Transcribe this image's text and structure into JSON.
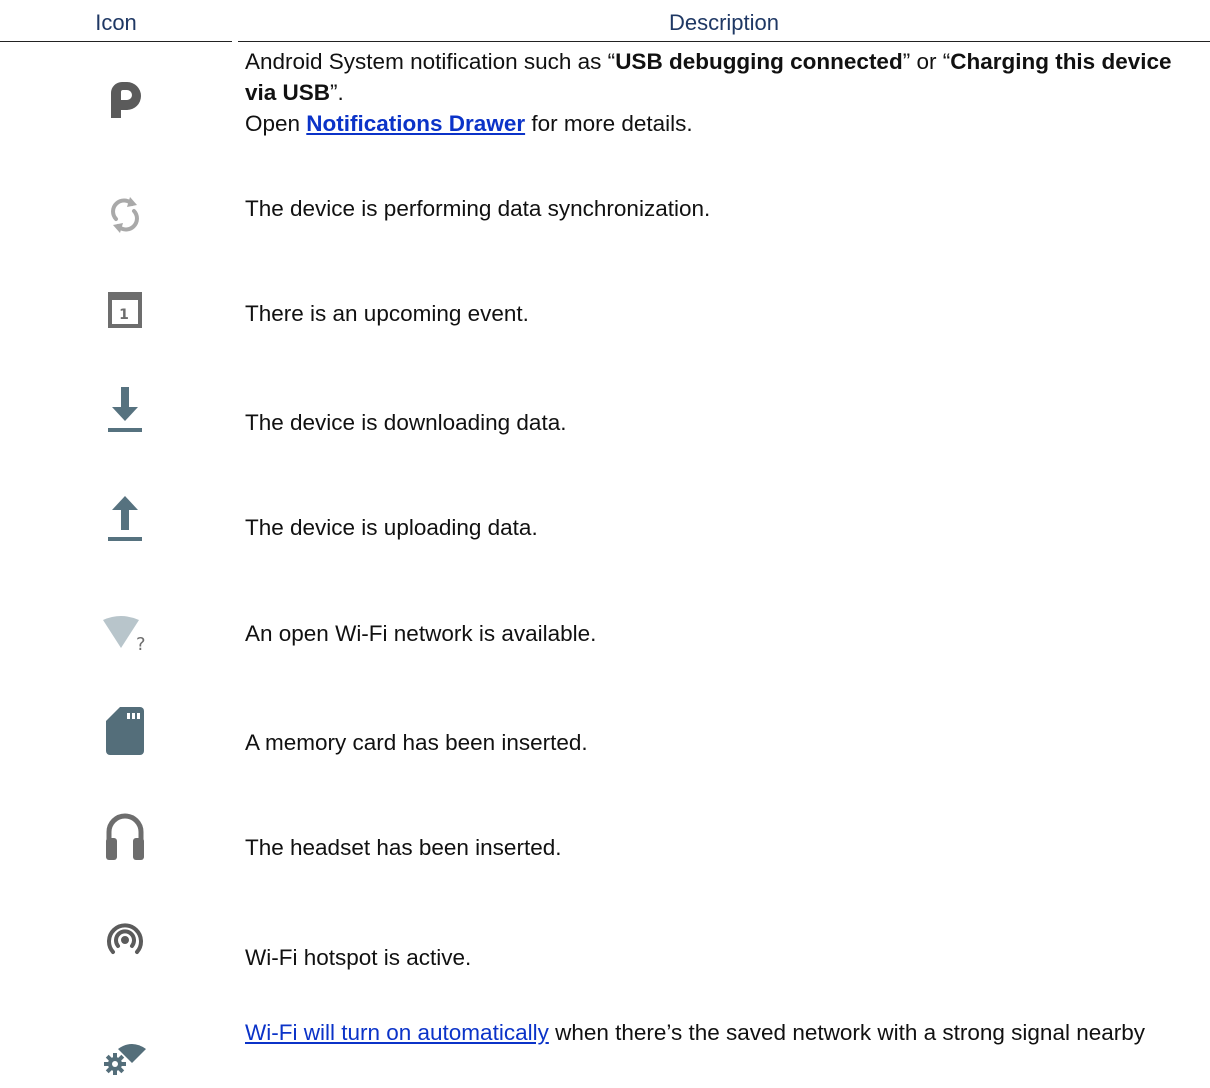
{
  "header": {
    "icon_label": "Icon",
    "description_label": "Description"
  },
  "rows": [
    {
      "icon": "android-system-p-icon",
      "text_1": "Android System notification such as “",
      "bold_1": "USB debugging connected",
      "text_2": "” or “",
      "bold_2": "Charging this device via USB",
      "text_3": "”.",
      "line2_prefix": "Open ",
      "line2_link": "Notifications Drawer",
      "line2_suffix": " for more details."
    },
    {
      "icon": "sync-icon",
      "text": "The device is performing data synchronization."
    },
    {
      "icon": "calendar-icon",
      "calendar_day": "1",
      "text": "There is an upcoming event."
    },
    {
      "icon": "download-icon",
      "text": "The device is downloading data."
    },
    {
      "icon": "upload-icon",
      "text": "The device is uploading data."
    },
    {
      "icon": "open-wifi-icon",
      "wifi_mark": "?",
      "text": "An open Wi-Fi network is available."
    },
    {
      "icon": "sd-card-icon",
      "text": "A memory card has been inserted."
    },
    {
      "icon": "headset-icon",
      "text": "The headset has been inserted."
    },
    {
      "icon": "hotspot-icon",
      "text": "Wi-Fi hotspot is active."
    },
    {
      "icon": "wifi-auto-settings-icon",
      "link": "Wi-Fi will turn on automatically",
      "text": " when there’s the saved network with a strong signal nearby"
    }
  ],
  "colors": {
    "header_text": "#1f3864",
    "link": "#0b33c8",
    "icon_gray": "#6d6d6d",
    "icon_slate": "#546e7a"
  }
}
